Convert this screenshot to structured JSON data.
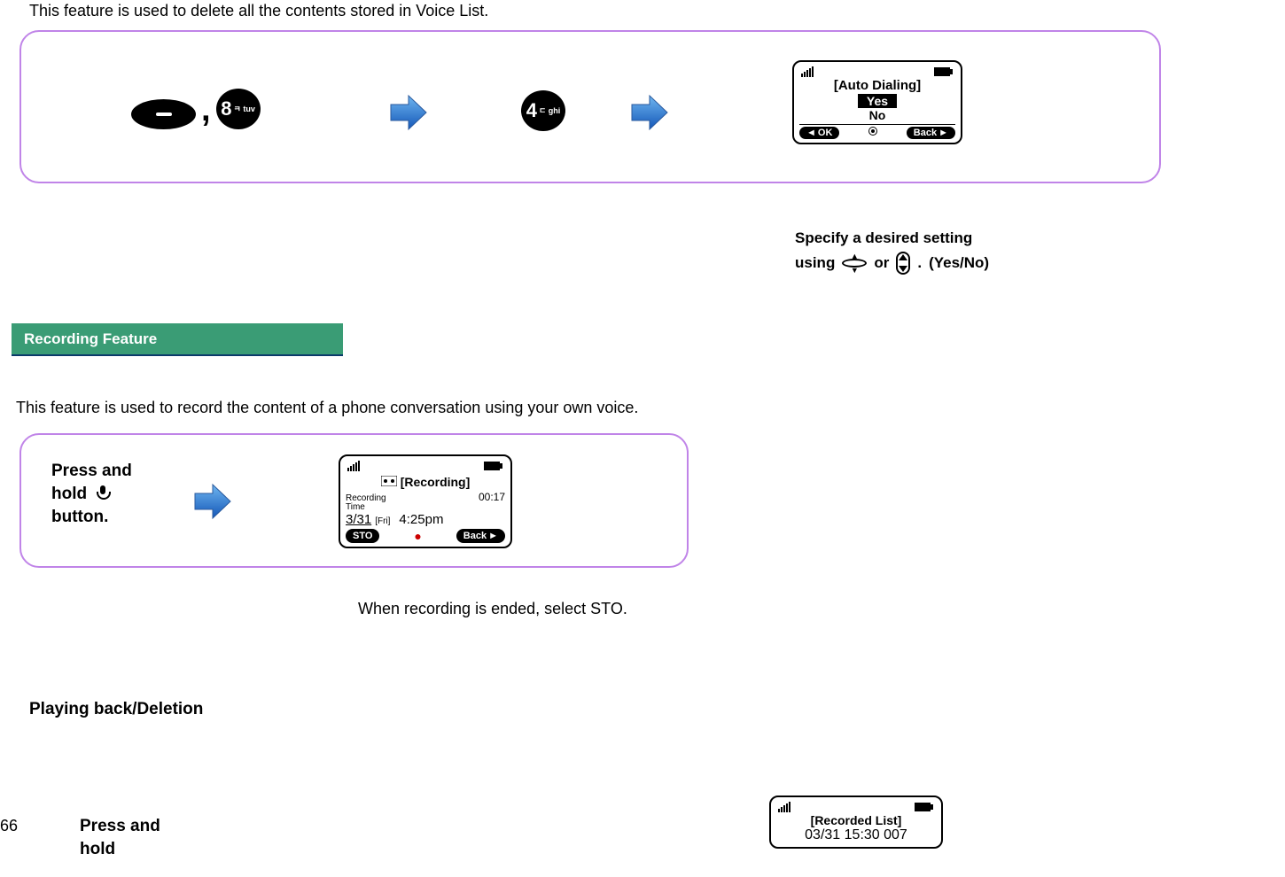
{
  "intro": "This feature is used to delete all the contents stored in Voice List.",
  "box1": {
    "key8": "8",
    "key8sub": "ㅋ\ntuv",
    "key4": "4",
    "key4sub": "ㄷ\nghi",
    "comma": ","
  },
  "screen1": {
    "title": "[Auto Dialing]",
    "optYes": "Yes",
    "optNo": "No",
    "softLeft": "OK",
    "softRight": "Back"
  },
  "specify": {
    "line1": "Specify a desired setting",
    "using": "using",
    "or": "or",
    "dot": ".",
    "yesno": "(Yes/No)"
  },
  "heading_recording": "Recording Feature",
  "recording_desc": "This feature is used to record the content of a phone conversation using your own voice.",
  "press1": {
    "l1": "Press and",
    "l2a": "hold",
    "l3": "button."
  },
  "screen2": {
    "title": "[Recording]",
    "label": "Recording\nTime",
    "time": "00:17",
    "date": "3/31",
    "day": "[Fri]",
    "clock": "4:25pm",
    "softLeft": "STO",
    "softRight": "Back"
  },
  "rec_end": "When recording is ended, select STO.",
  "subheading3": "Playing back/Deletion",
  "page": "66",
  "press2": {
    "l1": "Press and",
    "l2": "hold"
  },
  "screen3": {
    "title": "[Recorded List]",
    "entry": "03/31 15:30 007"
  }
}
